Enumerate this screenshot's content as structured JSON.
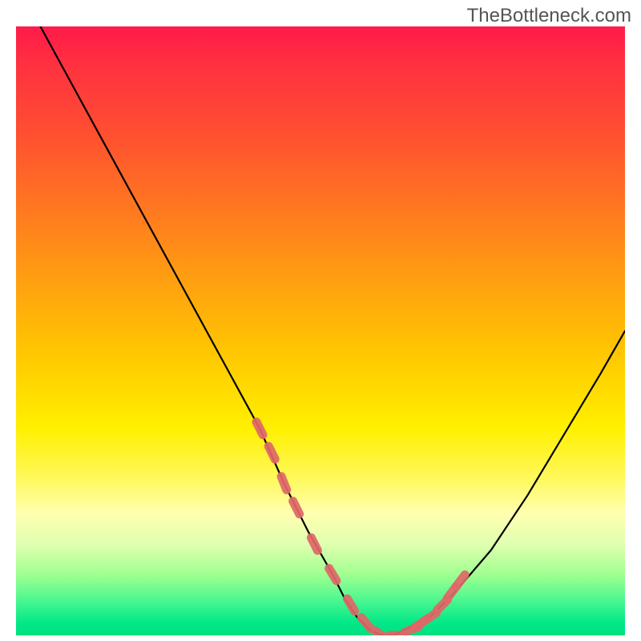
{
  "watermark": "TheBottleneck.com",
  "chart_data": {
    "type": "line",
    "title": "",
    "xlabel": "",
    "ylabel": "",
    "xlim": [
      0,
      100
    ],
    "ylim": [
      0,
      100
    ],
    "gradient_stops": [
      {
        "pos": 0,
        "color": "#ff1a4a"
      },
      {
        "pos": 20,
        "color": "#ff6028"
      },
      {
        "pos": 40,
        "color": "#ffa010"
      },
      {
        "pos": 60,
        "color": "#ffe000"
      },
      {
        "pos": 75,
        "color": "#fff880"
      },
      {
        "pos": 88,
        "color": "#c0ffa0"
      },
      {
        "pos": 100,
        "color": "#00e080"
      }
    ],
    "series": [
      {
        "name": "bottleneck-curve",
        "color": "#000000",
        "x": [
          4,
          10,
          16,
          22,
          28,
          34,
          40,
          44,
          48,
          52,
          54,
          56,
          58,
          60,
          62,
          64,
          68,
          72,
          78,
          84,
          90,
          96,
          100
        ],
        "values": [
          100,
          89,
          78,
          67,
          56,
          45,
          34,
          25,
          17,
          10,
          6,
          3,
          1,
          0,
          0,
          1,
          3,
          7,
          14,
          23,
          33,
          43,
          50
        ]
      }
    ],
    "markers": {
      "name": "highlighted-points",
      "color": "#e06868",
      "x": [
        40,
        42,
        44,
        46,
        49,
        52,
        55,
        57.5,
        60,
        62.5,
        65,
        66.5,
        68,
        70,
        71.5,
        73
      ],
      "values": [
        34,
        30,
        25,
        21,
        15,
        10,
        5,
        2,
        0,
        0,
        1,
        2,
        3,
        5,
        7,
        9
      ]
    }
  }
}
